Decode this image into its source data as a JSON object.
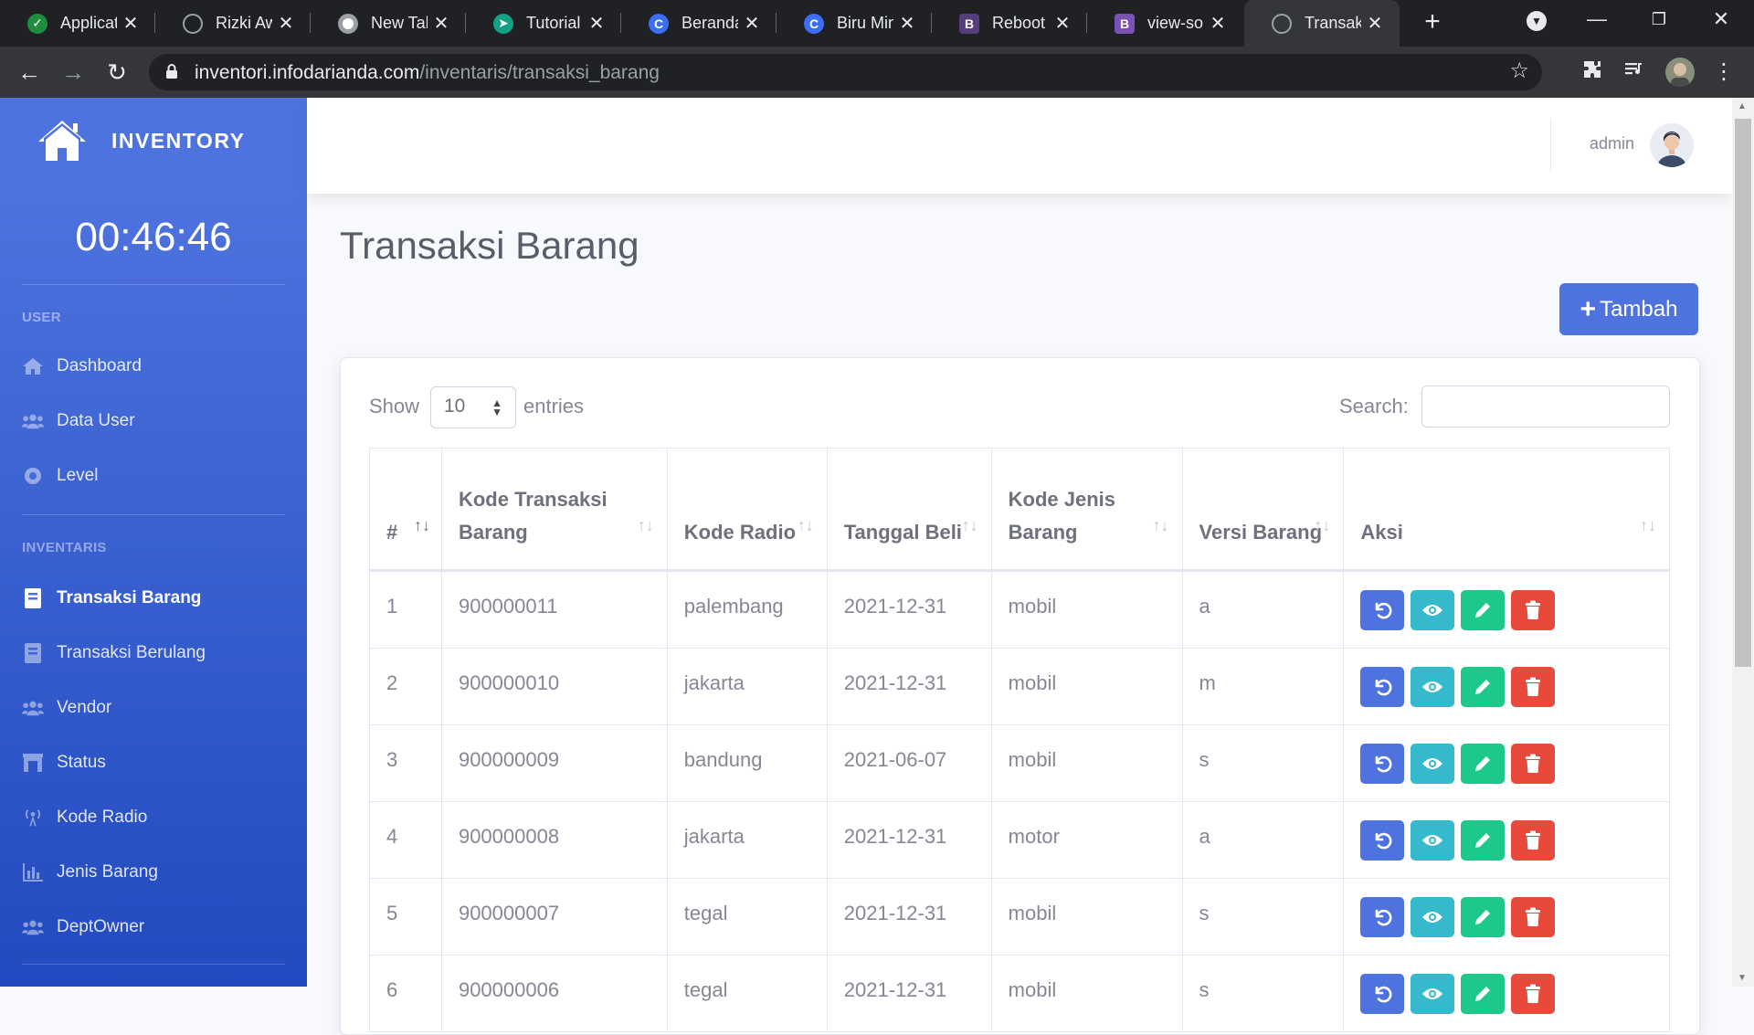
{
  "browser": {
    "tabs": [
      {
        "title": "Applicati",
        "favicon": "check-circle-icon",
        "color": "#1e8e3e"
      },
      {
        "title": "Rizki Awa",
        "favicon": "globe-icon",
        "color": "#9aa0a6"
      },
      {
        "title": "New Tab",
        "favicon": "chrome-icon",
        "color": "#9aa0a6"
      },
      {
        "title": "Tutorial (",
        "favicon": "bird-icon",
        "color": "#14a085"
      },
      {
        "title": "Beranda",
        "favicon": "canva-icon",
        "color": "#3b6ef5"
      },
      {
        "title": "Biru Mini",
        "favicon": "canva-icon",
        "color": "#3b6ef5"
      },
      {
        "title": "Reboot ·",
        "favicon": "bootstrap-icon",
        "color": "#563d7c"
      },
      {
        "title": "view-sou",
        "favicon": "bootstrap-icon",
        "color": "#7952b3"
      },
      {
        "title": "Transaksi",
        "favicon": "globe-icon",
        "color": "#9aa0a6",
        "active": true
      }
    ],
    "url_host": "inventori.infodarianda.com",
    "url_path": "/inventaris/transaksi_barang"
  },
  "sidebar": {
    "brand": "INVENTORY",
    "clock": "00:46:46",
    "section_user": "USER",
    "section_inventaris": "INVENTARIS",
    "user_items": [
      {
        "label": "Dashboard",
        "icon": "home-icon"
      },
      {
        "label": "Data User",
        "icon": "users-icon"
      },
      {
        "label": "Level",
        "icon": "circle-icon"
      }
    ],
    "inventaris_items": [
      {
        "label": "Transaksi Barang",
        "icon": "book-icon",
        "active": true
      },
      {
        "label": "Transaksi Berulang",
        "icon": "book-icon"
      },
      {
        "label": "Vendor",
        "icon": "users-icon"
      },
      {
        "label": "Status",
        "icon": "archway-icon"
      },
      {
        "label": "Kode Radio",
        "icon": "broadcast-icon"
      },
      {
        "label": "Jenis Barang",
        "icon": "chart-icon"
      },
      {
        "label": "DeptOwner",
        "icon": "users-icon"
      }
    ]
  },
  "topbar": {
    "username": "admin"
  },
  "page": {
    "title": "Transaksi Barang",
    "add_button": "Tambah",
    "show_label": "Show",
    "entries_label": "entries",
    "page_length": "10",
    "search_label": "Search:",
    "search_value": ""
  },
  "table": {
    "headers": [
      "#",
      "Kode Transaksi Barang",
      "Kode Radio",
      "Tanggal Beli",
      "Kode Jenis Barang",
      "Versi Barang",
      "Aksi"
    ],
    "rows": [
      [
        "1",
        "900000011",
        "palembang",
        "2021-12-31",
        "mobil",
        "a"
      ],
      [
        "2",
        "900000010",
        "jakarta",
        "2021-12-31",
        "mobil",
        "m"
      ],
      [
        "3",
        "900000009",
        "bandung",
        "2021-06-07",
        "mobil",
        "s"
      ],
      [
        "4",
        "900000008",
        "jakarta",
        "2021-12-31",
        "motor",
        "a"
      ],
      [
        "5",
        "900000007",
        "tegal",
        "2021-12-31",
        "mobil",
        "s"
      ],
      [
        "6",
        "900000006",
        "tegal",
        "2021-12-31",
        "mobil",
        "s"
      ]
    ],
    "actions": [
      "undo-icon",
      "eye-icon",
      "pencil-icon",
      "trash-icon"
    ]
  },
  "colors": {
    "primary": "#4e73df",
    "info": "#36b9cc",
    "success": "#1cc88a",
    "danger": "#e74a3b"
  }
}
